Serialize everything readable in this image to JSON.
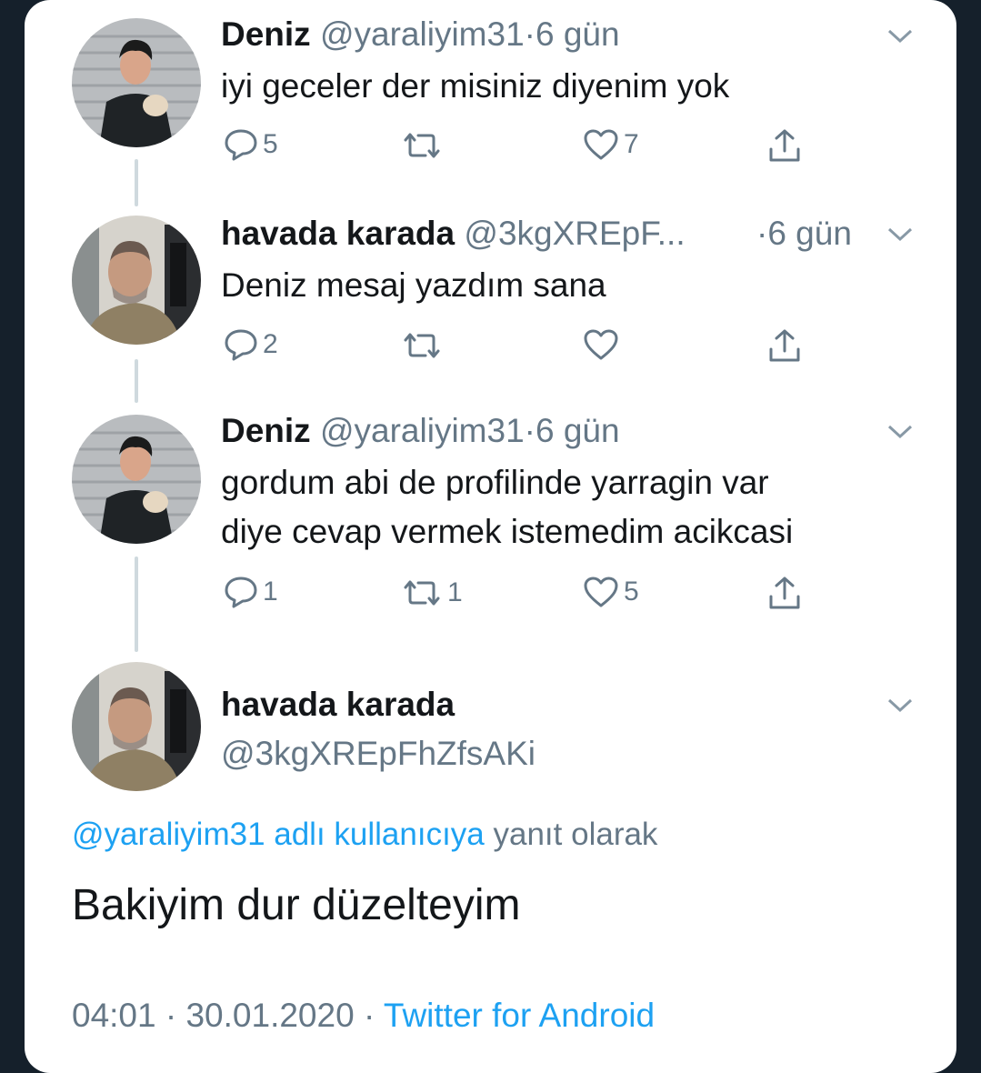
{
  "thread": [
    {
      "name": "Deniz",
      "handle": "@yaraliyim31",
      "sep": "·",
      "time": "6 gün",
      "text_lines": [
        "iyi geceler der misiniz diyenim yok"
      ],
      "replies": "5",
      "retweets": "",
      "likes": "7"
    },
    {
      "name": "havada karada",
      "handle": "@3kgXREpF...",
      "sep": "·",
      "time": "6 gün",
      "text_lines": [
        "Deniz mesaj yazdım sana"
      ],
      "replies": "2",
      "retweets": "",
      "likes": ""
    },
    {
      "name": "Deniz",
      "handle": "@yaraliyim31",
      "sep": "·",
      "time": "6 gün",
      "text_lines": [
        "gordum abi de profilinde yarragin var",
        "diye cevap vermek istemedim acikcasi"
      ],
      "replies": "1",
      "retweets": "1",
      "likes": "5"
    }
  ],
  "main_tweet": {
    "name": "havada karada",
    "handle": "@3kgXREpFhZfsAKi",
    "reply_to_link": "@yaraliyim31 adlı kullanıcıya",
    "reply_to_suffix": " yanıt olarak",
    "text": "Bakiyim dur düzelteyim",
    "time": "04:01",
    "sep1": " · ",
    "date": "30.01.2020",
    "sep2": " · ",
    "source": "Twitter for Android"
  },
  "colors": {
    "text": "#14171a",
    "secondary": "#657786",
    "link": "#1da1f2",
    "thread_line": "#cfd9de"
  },
  "icons": [
    "reply-icon",
    "retweet-icon",
    "like-icon",
    "share-icon",
    "chevron-down-icon"
  ]
}
